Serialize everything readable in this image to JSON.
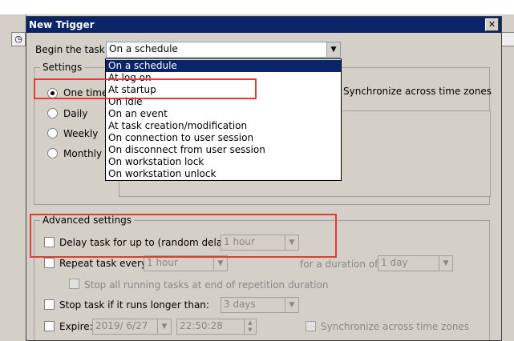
{
  "dialog": {
    "title": "New Trigger",
    "close_label": "✕",
    "begin_task_label": "Begin the task:",
    "begin_task_value": "On a schedule"
  },
  "dropdown_options": [
    "On a schedule",
    "At log on",
    "At startup",
    "On idle",
    "On an event",
    "At task creation/modification",
    "On connection to user session",
    "On disconnect from user session",
    "On workstation lock",
    "On workstation unlock"
  ],
  "settings": {
    "group_title": "Settings",
    "radios": [
      "One time",
      "Daily",
      "Weekly",
      "Monthly"
    ],
    "sync_label": "Synchronize across time zones"
  },
  "advanced": {
    "group_title": "Advanced settings",
    "delay_label": "Delay task for up to (random delay):",
    "delay_value": "1 hour",
    "repeat_label": "Repeat task every:",
    "repeat_value": "1 hour",
    "duration_label": "for a duration of:",
    "duration_value": "1 day",
    "stop_all_label": "Stop all running tasks at end of repetition duration",
    "stop_longer_label": "Stop task if it runs longer than:",
    "stop_longer_value": "3 days",
    "expire_label": "Expire:",
    "expire_date": "2019/ 6/27",
    "expire_time": "22:50:28",
    "expire_sync_label": "Synchronize across time zones"
  },
  "colors": {
    "titlebar": "#0a246a",
    "highlight": "#e53935",
    "dialog_bg": "#d4d0c8"
  }
}
